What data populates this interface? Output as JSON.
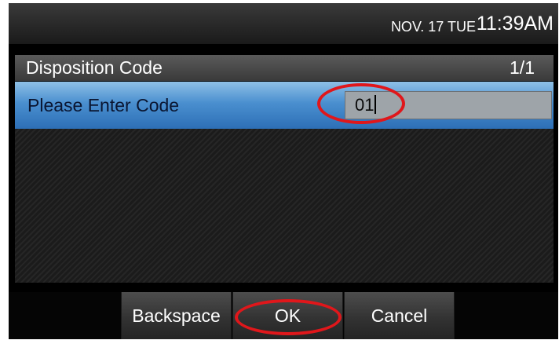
{
  "status": {
    "date": "NOV. 17 TUE",
    "time": "11:39AM"
  },
  "screen": {
    "title": "Disposition Code",
    "page": "1/1"
  },
  "form": {
    "label": "Please Enter Code",
    "code_value": "01"
  },
  "softkeys": [
    {
      "label": "Backspace"
    },
    {
      "label": "OK"
    },
    {
      "label": "Cancel"
    }
  ],
  "colors": {
    "highlight": "#2d6fb6",
    "annotation": "#e0171b"
  }
}
